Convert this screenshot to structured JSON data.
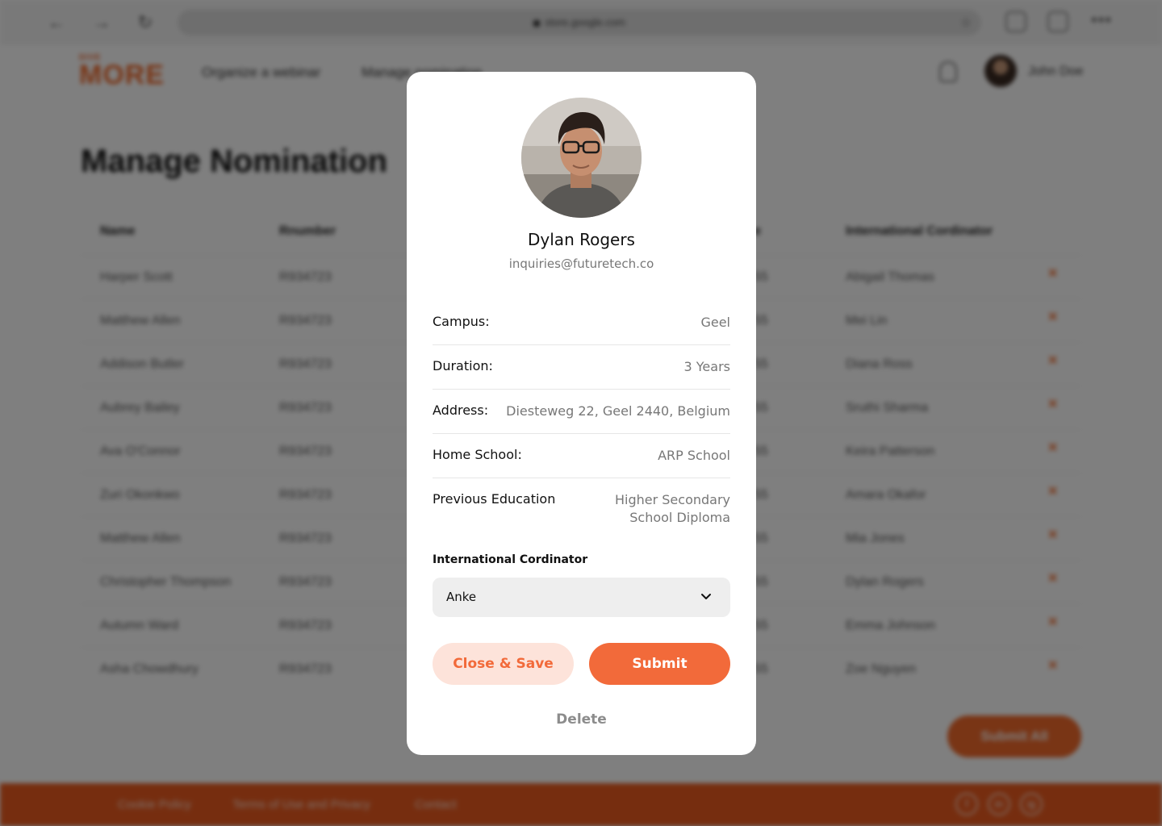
{
  "browser": {
    "url": "store.google.com",
    "back_icon": "arrow-left-icon",
    "forward_icon": "arrow-right-icon",
    "reload_icon": "reload-icon"
  },
  "header": {
    "logo_small": "DIVE",
    "logo_big": "MORE",
    "nav": [
      "Organize a webinar",
      "Manage nomination"
    ],
    "user_name": "John Doe"
  },
  "page": {
    "title": "Manage Nomination",
    "columns": [
      "Name",
      "Rnumber",
      "e",
      "International Cordinator"
    ],
    "rows": [
      {
        "name": "Harper Scott",
        "rnumber": "R934723",
        "col3": "55",
        "coordinator": "Abigail Thomas"
      },
      {
        "name": "Matthew Allen",
        "rnumber": "R934723",
        "col3": "55",
        "coordinator": "Mei Lin"
      },
      {
        "name": "Addison Butler",
        "rnumber": "R934723",
        "col3": "55",
        "coordinator": "Diana Ross"
      },
      {
        "name": "Aubrey Bailey",
        "rnumber": "R934723",
        "col3": "55",
        "coordinator": "Sruthi Sharma"
      },
      {
        "name": "Ava O'Connor",
        "rnumber": "R934723",
        "col3": "55",
        "coordinator": "Keira Patterson"
      },
      {
        "name": "Zuri Okonkwo",
        "rnumber": "R934723",
        "col3": "55",
        "coordinator": "Amara Okafor"
      },
      {
        "name": "Matthew Allen",
        "rnumber": "R934723",
        "col3": "55",
        "coordinator": "Mia Jones"
      },
      {
        "name": "Christopher Thompson",
        "rnumber": "R934723",
        "col3": "55",
        "coordinator": "Dylan Rogers"
      },
      {
        "name": "Autumn Ward",
        "rnumber": "R934723",
        "col3": "55",
        "coordinator": "Emma Johnson"
      },
      {
        "name": "Asha Chowdhury",
        "rnumber": "R934723",
        "col3": "55",
        "coordinator": "Zoe Nguyen"
      }
    ],
    "submit_all": "Submit All"
  },
  "footer": {
    "links": [
      "Cookie Policy",
      "Terms of Use and Privacy",
      "Contact"
    ],
    "social": [
      "f",
      "in",
      "ig"
    ]
  },
  "modal": {
    "name": "Dylan Rogers",
    "email": "inquiries@futuretech.co",
    "details": [
      {
        "label": "Campus:",
        "value": "Geel"
      },
      {
        "label": "Duration:",
        "value": "3 Years"
      },
      {
        "label": "Address:",
        "value": "Diesteweg 22, Geel 2440, Belgium"
      },
      {
        "label": "Home School:",
        "value": "ARP School"
      },
      {
        "label": "Previous Education",
        "value_line1": "Higher Secondary",
        "value_line2": "School Diploma"
      }
    ],
    "coordinator_label": "International Cordinator",
    "coordinator_value": "Anke",
    "close_save": "Close & Save",
    "submit": "Submit",
    "delete": "Delete"
  },
  "colors": {
    "accent": "#f26a3a",
    "accent_soft": "#fde3da",
    "footer": "#ec5b1f"
  }
}
